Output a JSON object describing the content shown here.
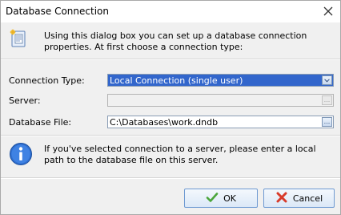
{
  "window": {
    "title": "Database Connection"
  },
  "intro": {
    "text": "Using this dialog box you can set up a database connection properties. At first choose a connection type:"
  },
  "form": {
    "connection_type": {
      "label": "Connection Type:",
      "value": "Local Connection (single user)"
    },
    "server": {
      "label": "Server:",
      "value": ""
    },
    "database_file": {
      "label": "Database File:",
      "value": "C:\\Databases\\work.dndb"
    }
  },
  "note": {
    "text": "If you've selected connection to a server, please enter a local path to the database file on this server."
  },
  "buttons": {
    "ok": "OK",
    "cancel": "Cancel",
    "browse": "..."
  },
  "icons": {
    "intro": "database-settings-icon",
    "info": "info-icon",
    "ok": "checkmark-icon",
    "cancel": "x-icon",
    "close": "close-icon"
  },
  "colors": {
    "selection": "#3266cc",
    "ok_check": "#4aa53a",
    "cancel_x": "#d83b2b",
    "info_blue": "#2f6fd1"
  }
}
